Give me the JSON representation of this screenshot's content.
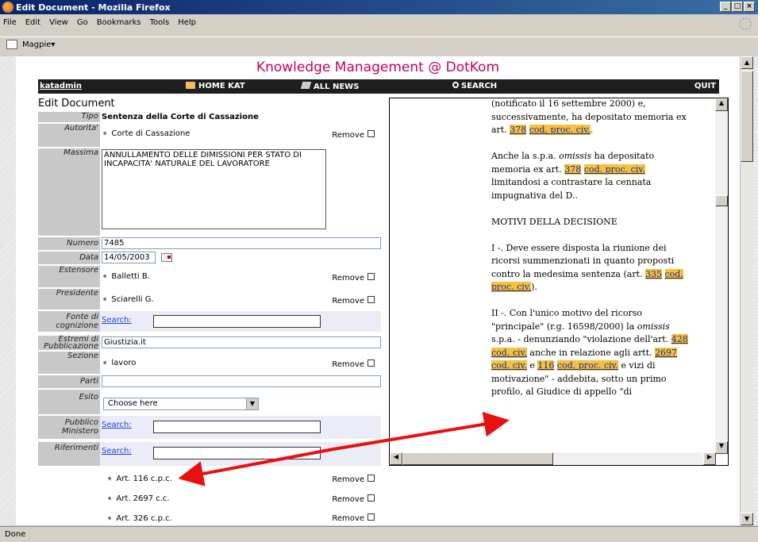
{
  "window": {
    "title": "Edit Document - Mozilla Firefox",
    "min": "_",
    "max": "□",
    "close": "×"
  },
  "menu": [
    "File",
    "Edit",
    "View",
    "Go",
    "Bookmarks",
    "Tools",
    "Help"
  ],
  "bookmark": {
    "label": "Magpie▾"
  },
  "status": "Done",
  "page": {
    "title": "Knowledge Management @ DotKom",
    "nav": {
      "user": "katadmin",
      "home": "HOME KAT",
      "news": "ALL NEWS",
      "search": "SEARCH",
      "quit": "QUIT"
    },
    "form_title": "Edit Document",
    "remove": "Remove",
    "search_link": "Search:",
    "fields": {
      "tipo": {
        "label": "Tipo",
        "value": "Sentenza della Corte di Cassazione"
      },
      "autorita": {
        "label": "Autorita'",
        "value": "Corte di Cassazione"
      },
      "massima": {
        "label": "Massima",
        "value": "ANNULLAMENTO DELLE DIMISSIONI PER STATO DI INCAPACITA' NATURALE DEL LAVORATORE"
      },
      "numero": {
        "label": "Numero",
        "value": "7485"
      },
      "data": {
        "label": "Data",
        "value": "14/05/2003"
      },
      "estensore": {
        "label": "Estensore",
        "value": "Balletti B."
      },
      "presidente": {
        "label": "Presidente",
        "value": "Sciarelli G."
      },
      "fonte": {
        "label": "Fonte di cognizione"
      },
      "estremi": {
        "label": "Estremi di Pubblicazione",
        "value": "Giustizia.it"
      },
      "sezione": {
        "label": "Sezione",
        "value": "lavoro"
      },
      "parti": {
        "label": "Parti",
        "value": ""
      },
      "esito": {
        "label": "Esito",
        "value": "Choose here"
      },
      "pm": {
        "label": "Pubblico Ministero"
      },
      "riferimenti": {
        "label": "Riferimenti",
        "items": [
          "Art. 116 c.p.c.",
          "Art. 2697 c.c.",
          "Art. 326 c.p.c."
        ]
      }
    },
    "viewer": {
      "p1a": "(notificato il 16 settembre 2000) e, successivamente, ha depositato memoria ex art. ",
      "p1n": "378",
      "p1l": "cod. proc. civ.",
      "p1e": ".",
      "p2a": "Anche la s.p.a. ",
      "p2i": "omissis",
      "p2b": " ha depositato memoria ex art. ",
      "p2n": "378",
      "p2l": "cod. proc. civ.",
      "p2e": " limitandosi a contrastare la cennata impugnativa del D..",
      "p3": "MOTIVI DELLA DECISIONE",
      "p4a": "I -. Deve essere disposta la riunione dei ricorsi summenzionati in quanto proposti contro la medesima sentenza (art. ",
      "p4n": "335",
      "p4l": "cod. proc. civ.",
      "p4e": ").",
      "p5a": "II -. Con l'unico motivo del ricorso \"principale\" (r.g. 16598/2000) la ",
      "p5i": "omissis",
      "p5b": " s.p.a. - denunziando \"violazione dell'art. ",
      "p5n1": "428",
      "p5l1": "cod. civ.",
      "p5c": " anche in relazione agli artt. ",
      "p5n2": "2697",
      "p5l2": "cod. civ.",
      "p5d": " e ",
      "p5n3": "116",
      "p5l3": "cod. proc. civ.",
      "p5e": " e vizi di motivazione\" - addebita, sotto un primo profilo, al Giudice di appello \"di"
    }
  }
}
